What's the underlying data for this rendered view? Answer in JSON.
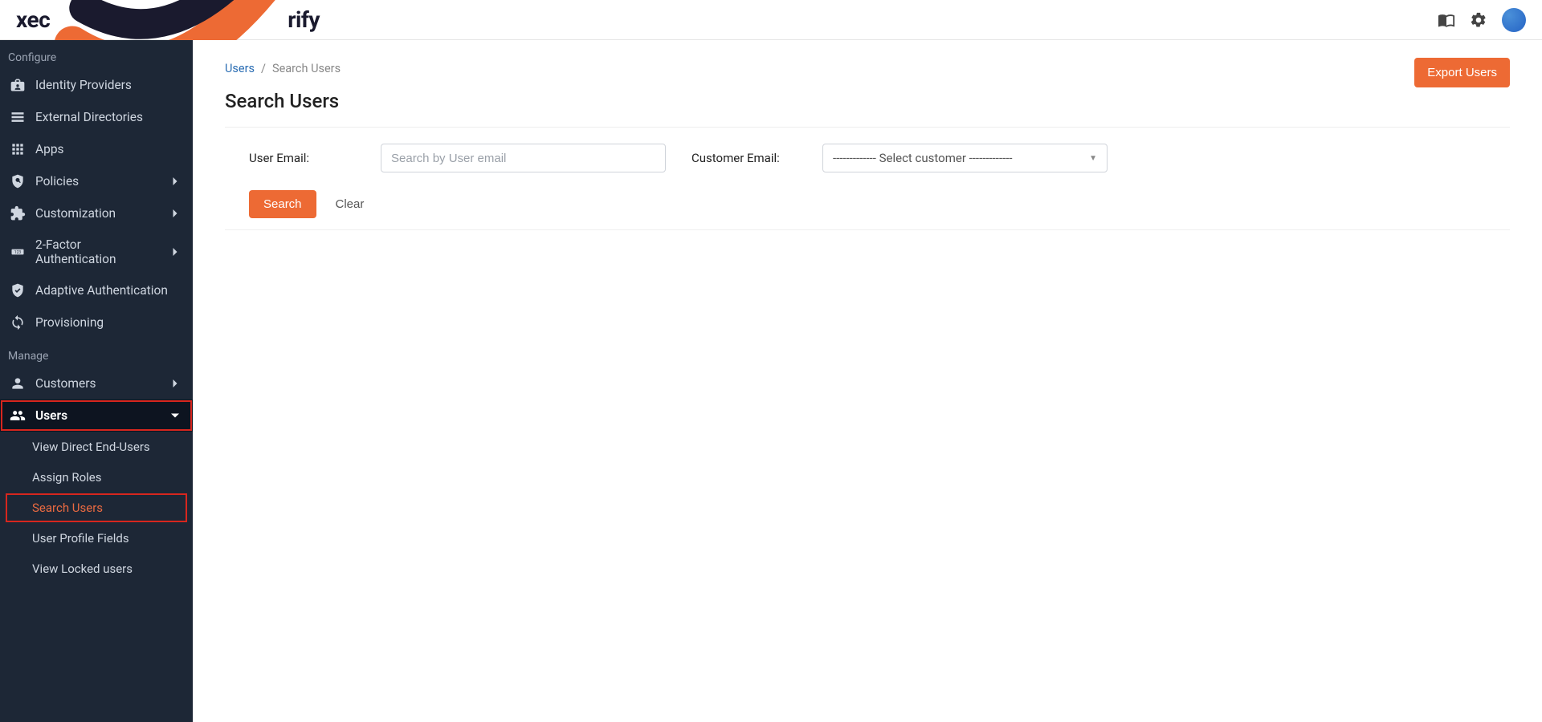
{
  "brand": {
    "prefix": "xec",
    "suffix": "rify"
  },
  "sidebar": {
    "sections": {
      "configure": "Configure",
      "manage": "Manage"
    },
    "items": {
      "identity_providers": "Identity Providers",
      "external_directories": "External Directories",
      "apps": "Apps",
      "policies": "Policies",
      "customization": "Customization",
      "two_factor": "2-Factor Authentication",
      "adaptive_auth": "Adaptive Authentication",
      "provisioning": "Provisioning",
      "customers": "Customers",
      "users": "Users"
    },
    "subitems": {
      "view_direct": "View Direct End-Users",
      "assign_roles": "Assign Roles",
      "search_users": "Search Users",
      "user_profile_fields": "User Profile Fields",
      "view_locked": "View Locked users"
    }
  },
  "breadcrumb": {
    "users": "Users",
    "search_users": "Search Users"
  },
  "buttons": {
    "export": "Export Users",
    "search": "Search",
    "clear": "Clear"
  },
  "page": {
    "title": "Search Users"
  },
  "form": {
    "user_email_label": "User Email:",
    "user_email_placeholder": "Search by User email",
    "customer_email_label": "Customer Email:",
    "customer_select_placeholder": "------------- Select customer -------------"
  }
}
